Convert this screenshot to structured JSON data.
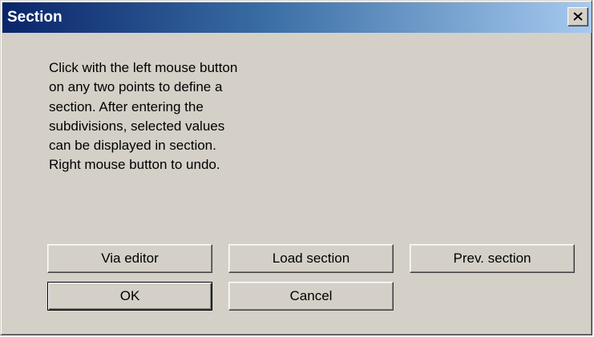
{
  "window": {
    "title": "Section",
    "close_icon": "close-icon"
  },
  "message": {
    "lines": [
      "Click with the left mouse button",
      "on any two points to define a",
      "section. After entering the",
      "subdivisions, selected values",
      "can be displayed in section.",
      "Right mouse button to undo."
    ]
  },
  "buttons": {
    "via_editor": "Via editor",
    "load_section": "Load section",
    "prev_section": "Prev. section",
    "ok": "OK",
    "cancel": "Cancel"
  },
  "colors": {
    "dialog_face": "#d4d0c8",
    "title_gradient_start": "#0a246a",
    "title_gradient_end": "#a6caf0",
    "title_text": "#ffffff"
  }
}
